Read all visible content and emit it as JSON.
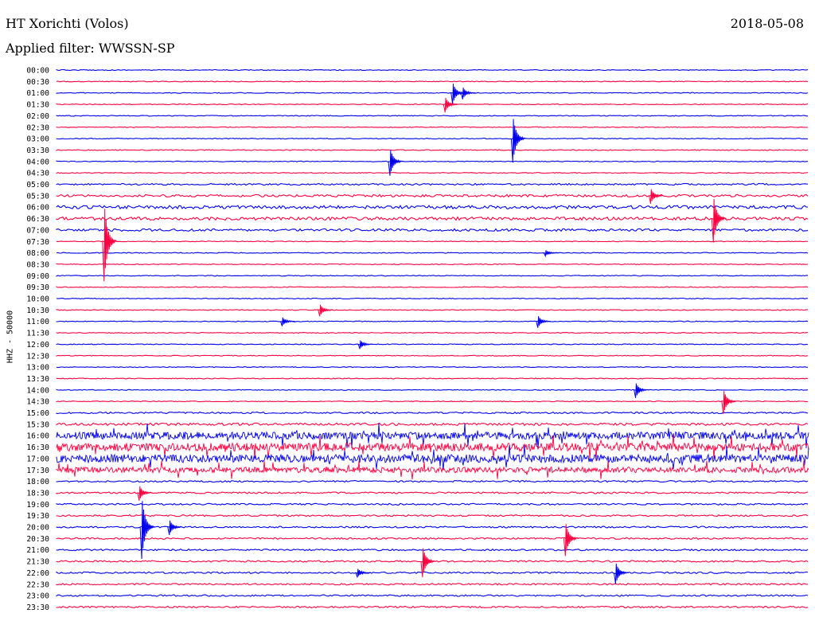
{
  "header": {
    "station": "HT Xorichti (Volos)",
    "date": "2018-05-08",
    "filter": "Applied filter: WWSSN-SP"
  },
  "side_label": "HHZ - 50000",
  "colors": {
    "odd": "#0000ee",
    "even": "#ff0040",
    "text": "#000000"
  },
  "chart_data": {
    "type": "helicorder",
    "title": "",
    "ylabel": "HHZ - 50000",
    "row_minutes": 30,
    "times": [
      "00:00",
      "00:30",
      "01:00",
      "01:30",
      "02:00",
      "02:30",
      "03:00",
      "03:30",
      "04:00",
      "04:30",
      "05:00",
      "05:30",
      "06:00",
      "06:30",
      "07:00",
      "07:30",
      "08:00",
      "08:30",
      "09:00",
      "09:30",
      "10:00",
      "10:30",
      "11:00",
      "11:30",
      "12:00",
      "12:30",
      "13:00",
      "13:30",
      "14:00",
      "14:30",
      "15:00",
      "15:30",
      "16:00",
      "16:30",
      "17:00",
      "17:30",
      "18:00",
      "18:30",
      "19:00",
      "19:30",
      "20:00",
      "20:30",
      "21:00",
      "21:30",
      "22:00",
      "22:30",
      "23:00",
      "23:30"
    ],
    "noise_level": [
      1,
      1,
      1,
      1,
      1,
      1,
      1,
      1,
      1,
      1,
      2,
      3,
      4,
      4,
      3,
      1,
      1,
      1,
      1,
      1,
      1,
      1,
      1,
      1,
      1,
      1,
      1,
      1,
      1,
      1,
      2,
      3,
      9,
      10,
      10,
      7,
      2,
      2,
      2,
      2,
      2,
      2,
      2,
      2,
      2,
      2,
      2,
      2
    ],
    "events": [
      {
        "row": "01:00",
        "minute": 15.8,
        "amplitude": 14
      },
      {
        "row": "01:30",
        "minute": 15.5,
        "amplitude": 10
      },
      {
        "row": "01:00",
        "minute": 16.2,
        "amplitude": 8
      },
      {
        "row": "03:00",
        "minute": 18.2,
        "amplitude": 30
      },
      {
        "row": "04:00",
        "minute": 13.3,
        "amplitude": 18
      },
      {
        "row": "05:30",
        "minute": 23.7,
        "amplitude": 10
      },
      {
        "row": "06:30",
        "minute": 26.2,
        "amplitude": 30
      },
      {
        "row": "07:30",
        "minute": 1.9,
        "amplitude": 50
      },
      {
        "row": "08:00",
        "minute": 19.5,
        "amplitude": 4
      },
      {
        "row": "10:30",
        "minute": 10.5,
        "amplitude": 8
      },
      {
        "row": "11:00",
        "minute": 9.0,
        "amplitude": 6
      },
      {
        "row": "11:00",
        "minute": 19.2,
        "amplitude": 8
      },
      {
        "row": "12:00",
        "minute": 12.1,
        "amplitude": 6
      },
      {
        "row": "14:00",
        "minute": 23.1,
        "amplitude": 10
      },
      {
        "row": "14:30",
        "minute": 26.6,
        "amplitude": 16
      },
      {
        "row": "18:30",
        "minute": 3.3,
        "amplitude": 10
      },
      {
        "row": "20:00",
        "minute": 3.4,
        "amplitude": 40
      },
      {
        "row": "20:00",
        "minute": 4.5,
        "amplitude": 10
      },
      {
        "row": "20:30",
        "minute": 20.3,
        "amplitude": 22
      },
      {
        "row": "21:30",
        "minute": 14.6,
        "amplitude": 20
      },
      {
        "row": "22:00",
        "minute": 12.0,
        "amplitude": 6
      },
      {
        "row": "22:00",
        "minute": 22.3,
        "amplitude": 14
      }
    ]
  }
}
